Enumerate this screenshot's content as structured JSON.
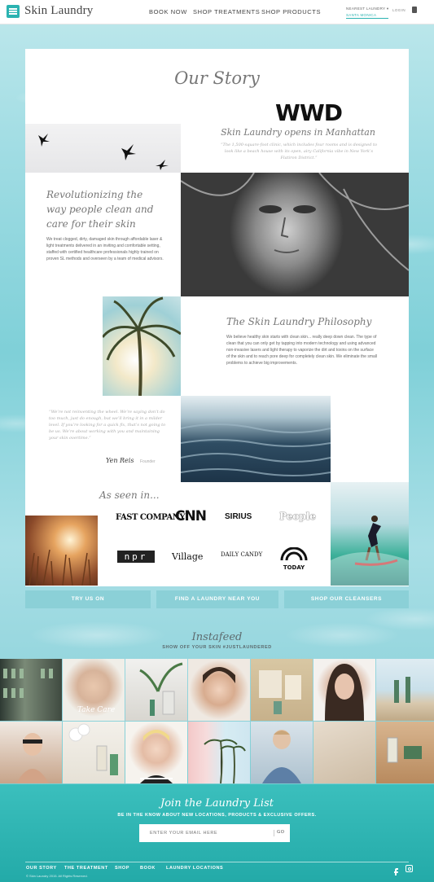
{
  "header": {
    "logo": "Skin Laundry",
    "nav": [
      "BOOK NOW",
      "SHOP TREATMENTS",
      "SHOP PRODUCTS"
    ],
    "location_label": "NEAREST LAUNDRY ▾",
    "location_value": "SANTA MONICA",
    "login": "LOGIN"
  },
  "story": {
    "heading": "Our Story",
    "wwd_logo": "WWD",
    "wwd_title": "Skin Laundry opens in Manhattan",
    "wwd_quote": "“The 1,500-square-foot clinic, which includes four rooms and is designed to look like a beach house with its open, airy California vibe in New York’s Flatiron District.”",
    "revolution_title": "Revolutionizing the way people clean and care for their skin",
    "revolution_body": "We treat clogged, dirty, damaged skin through affordable laser & light treatments delivered in an inviting and comfortable setting, staffed with certified healthcare professionals highly trained on proven SL methods and overseen by a team of medical advisors.",
    "philosophy_title": "The Skin Laundry Philosophy",
    "philosophy_body": "We believe healthy skin starts with clean skin... really deep down clean. The type of clean that you can only get by tapping into modern technology and using advanced non-invasive lasers and light therapy to vaporize the dirt and toxins on the surface of the skin and to reach pore deep for completely clean skin. We eliminate the small problems to achieve big improvements.",
    "founder_quote": "“We’re not reinventing the wheel. We’re saying don’t do too much, just do enough, but we’ll bring it in a milder level. If you’re looking for a quick fix, that’s not going to be us. We’re about working with you and maintaining your skin overtime.”",
    "signature": "Yen Reis",
    "founder_label": "Founder",
    "as_seen": "As seen in...",
    "press": [
      "FAST COMPANY",
      "CNN",
      "SIRIUS",
      "People",
      "npr",
      "Village",
      "DAILY CANDY",
      "TODAY"
    ]
  },
  "cta": [
    "TRY US ON",
    "FIND A LAUNDRY NEAR YOU",
    "SHOP OUR CLEANSERS"
  ],
  "insta": {
    "title": "Instafeed",
    "subtitle": "SHOW OFF YOUR SKIN  #JUSTLAUNDERED",
    "handwriting": "Take Care"
  },
  "signup": {
    "title": "Join the Laundry List",
    "subtitle": "BE IN THE KNOW ABOUT NEW LOCATIONS, PRODUCTS & EXCLUSIVE OFFERS.",
    "placeholder": "ENTER YOUR EMAIL HERE",
    "go": "GO"
  },
  "footer": {
    "links": [
      "OUR STORY",
      "THE TREATMENT",
      "SHOP",
      "BOOK",
      "LAUNDRY LOCATIONS"
    ],
    "copyright": "© Skin Laundry 2015. All Rights Reserved."
  },
  "colors": {
    "accent": "#2bb3b1",
    "cta": "#8bd0d7",
    "footer": "#2aaeac"
  }
}
